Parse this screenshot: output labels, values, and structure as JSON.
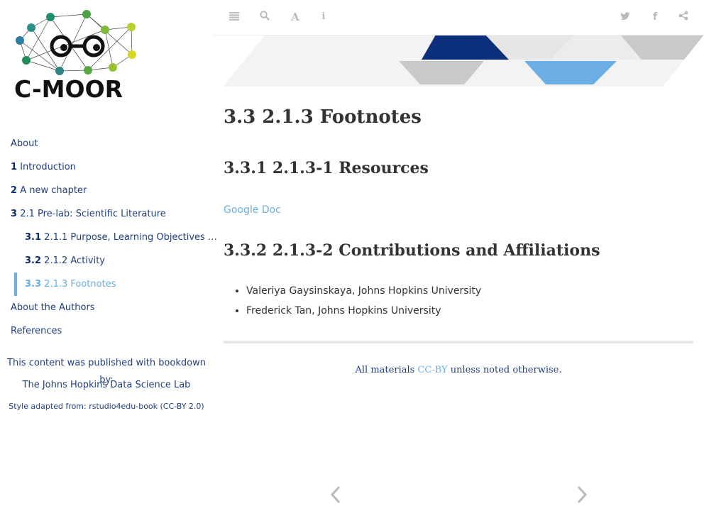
{
  "sidebar": {
    "logo_text": "C-MOOR",
    "toc": [
      {
        "num": "",
        "label": "About"
      },
      {
        "num": "1",
        "label": "Introduction"
      },
      {
        "num": "2",
        "label": "A new chapter"
      },
      {
        "num": "3",
        "label": "2.1 Pre-lab: Scientific Literature"
      },
      {
        "num": "3.1",
        "label": "2.1.1 Purpose, Learning Objectives …"
      },
      {
        "num": "3.2",
        "label": "2.1.2 Activity"
      },
      {
        "num": "3.3",
        "label": "2.1.3 Footnotes"
      },
      {
        "num": "",
        "label": "About the Authors"
      },
      {
        "num": "",
        "label": "References"
      }
    ],
    "credits": {
      "line1": "This content was published with bookdown by:",
      "line2": "The Johns Hopkins Data Science Lab",
      "line3": "Style adapted from: rstudio4edu-book (CC-BY 2.0)"
    }
  },
  "toolbar": {
    "icons": [
      "list-icon",
      "search-icon",
      "font-icon",
      "info-icon",
      "twitter-icon",
      "facebook-icon",
      "share-icon"
    ]
  },
  "main": {
    "h1": "3.3   2.1.3 Footnotes",
    "h2_resources": "3.3.1   2.1.3-1 Resources",
    "link": "Google Doc",
    "h2_contrib": "3.3.2   2.1.3-2 Contributions and Affiliations",
    "contributors": [
      "Valeriya Gaysinskaya, Johns Hopkins University",
      "Frederick Tan, Johns Hopkins University"
    ],
    "footer_pre": "All materials ",
    "footer_link": "CC-BY",
    "footer_post": " unless noted otherwise."
  },
  "colors": {
    "accent": "#6aaee3",
    "navy": "#0d2b6b",
    "text": "#333333"
  }
}
